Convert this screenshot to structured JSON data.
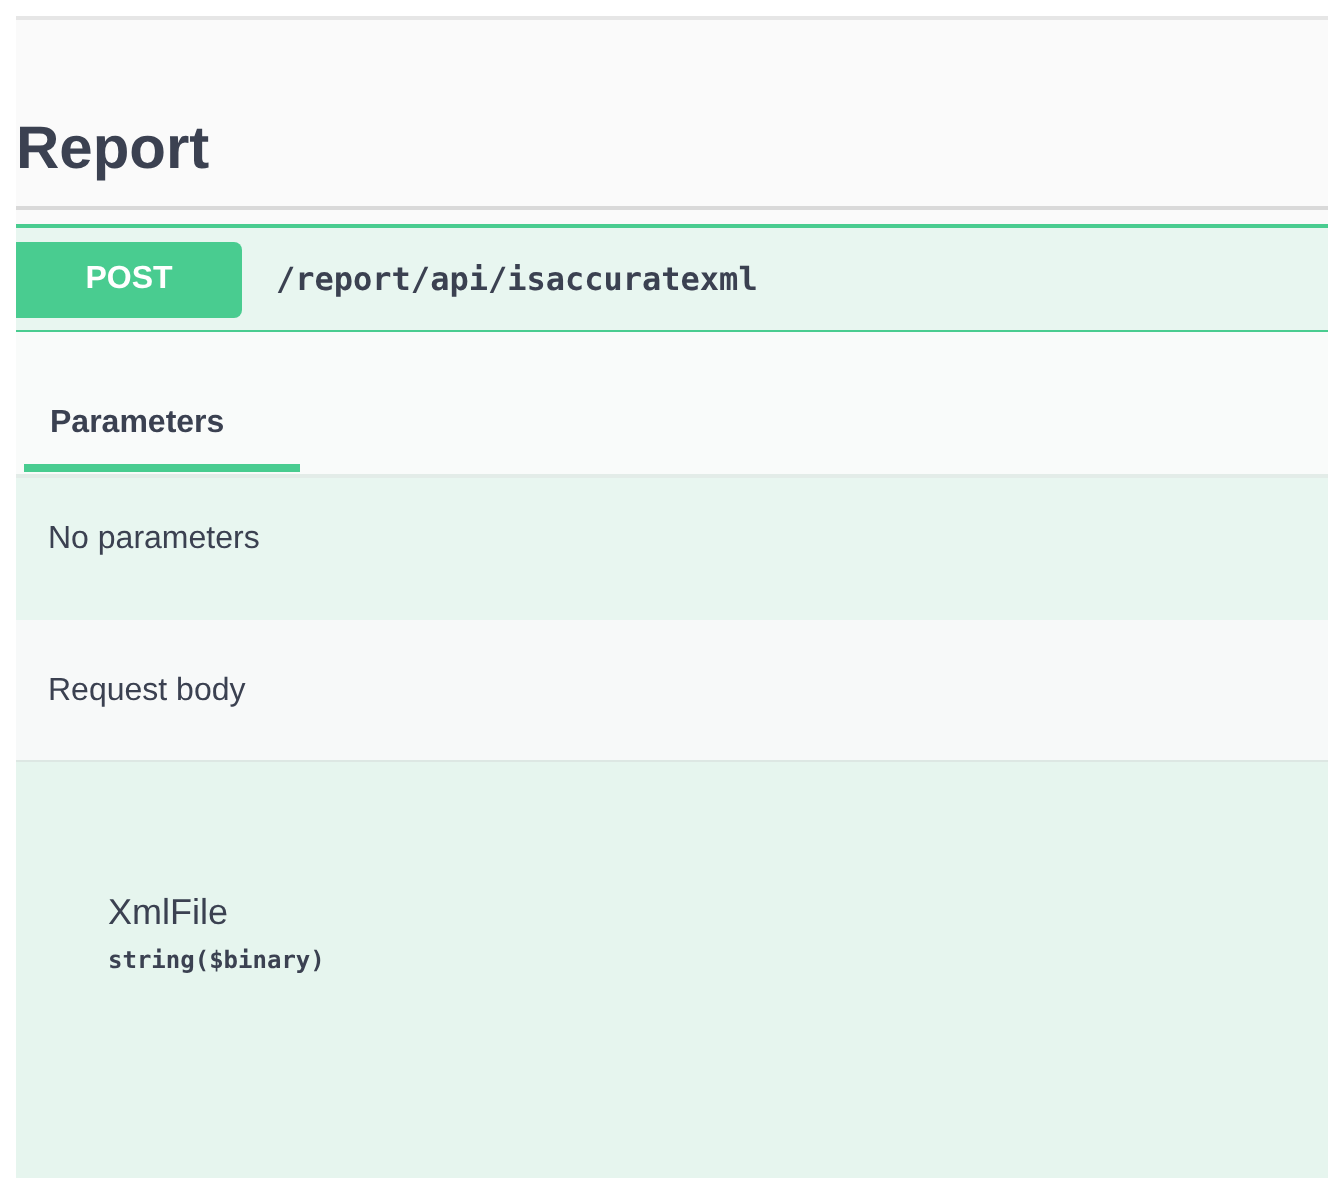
{
  "section": {
    "title": "Report"
  },
  "operation": {
    "method": "POST",
    "path": "/report/api/isaccuratexml"
  },
  "tabs": [
    {
      "label": "Parameters",
      "selected": true
    }
  ],
  "parameters_message": "No parameters",
  "request_body": {
    "label": "Request body",
    "fields": [
      {
        "name": "XmlFile",
        "type": "string($binary)"
      }
    ]
  }
}
